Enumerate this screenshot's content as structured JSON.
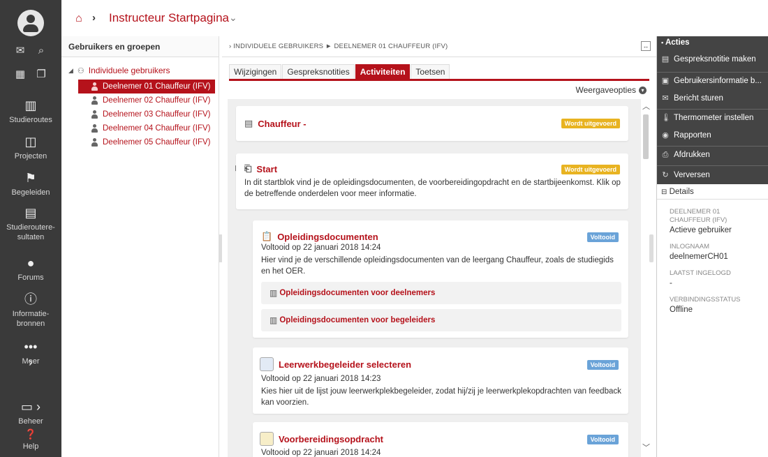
{
  "nav": {
    "items": [
      {
        "label": "Studieroutes"
      },
      {
        "label": "Projecten"
      },
      {
        "label": "Begeleiden"
      },
      {
        "label": "Studieroutere-sultaten"
      },
      {
        "label": "Forums"
      },
      {
        "label": "Informatie-bronnen"
      },
      {
        "label": "Meer"
      },
      {
        "label": "Beheer"
      },
      {
        "label": "Help"
      }
    ]
  },
  "header": {
    "title": "Instructeur Startpagina"
  },
  "users_panel": {
    "title": "Gebruikers en groepen",
    "root": "Individuele gebruikers",
    "users": [
      "Deelnemer 01 Chauffeur (IFV)",
      "Deelnemer 02 Chauffeur (IFV)",
      "Deelnemer 03 Chauffeur (IFV)",
      "Deelnemer 04 Chauffeur (IFV)",
      "Deelnemer 05 Chauffeur (IFV)"
    ]
  },
  "center": {
    "breadcrumb": "› INDIVIDUELE GEBRUIKERS ► DEELNEMER 01 CHAUFFEUR (IFV)",
    "tabs": [
      "Wijzigingen",
      "Gespreksnotities",
      "Activiteiten",
      "Toetsen"
    ],
    "view_options": "Weergaveopties",
    "cards": {
      "chauffeur": {
        "title": "Chauffeur -",
        "status": "Wordt uitgevoerd"
      },
      "start": {
        "title": "Start",
        "status": "Wordt uitgevoerd",
        "desc": "In dit startblok vind je de opleidingsdocumenten, de voorbereidingopdracht en de startbijeenkomst. Klik op de betreffende onderdelen voor meer informatie."
      },
      "docs": {
        "title": "Opleidingsdocumenten",
        "status": "Voltooid",
        "meta": "Voltooid op 22 januari 2018 14:24",
        "desc": "Hier vind je de verschillende opleidingsdocumenten van de leergang Chauffeur, zoals de studiegids en het OER.",
        "links": [
          "Opleidingsdocumenten voor deelnemers",
          "Opleidingsdocumenten voor begeleiders"
        ]
      },
      "select": {
        "title": "Leerwerkbegeleider selecteren",
        "status": "Voltooid",
        "meta": "Voltooid op 22 januari 2018 14:23",
        "desc": "Kies hier uit de lijst jouw leerwerkplekbegeleider, zodat hij/zij je leerwerkplekopdrachten van feedback kan voorzien."
      },
      "prep": {
        "title": "Voorbereidingsopdracht",
        "status": "Voltooid",
        "meta": "Voltooid op 22 januari 2018 14:24"
      }
    }
  },
  "right": {
    "actions_title": "Acties",
    "actions": [
      "Gespreksnotitie maken",
      "Gebruikersinformatie b...",
      "Bericht sturen",
      "Thermometer instellen",
      "Rapporten",
      "Afdrukken",
      "Verversen"
    ],
    "details_title": "Details",
    "details": [
      {
        "label": "DEELNEMER 01 CHAUFFEUR (IFV)",
        "value": "Actieve gebruiker"
      },
      {
        "label": "INLOGNAAM",
        "value": "deelnemerCH01"
      },
      {
        "label": "LAATST INGELOGD",
        "value": "-"
      },
      {
        "label": "VERBINDINGSSTATUS",
        "value": "Offline"
      }
    ]
  }
}
